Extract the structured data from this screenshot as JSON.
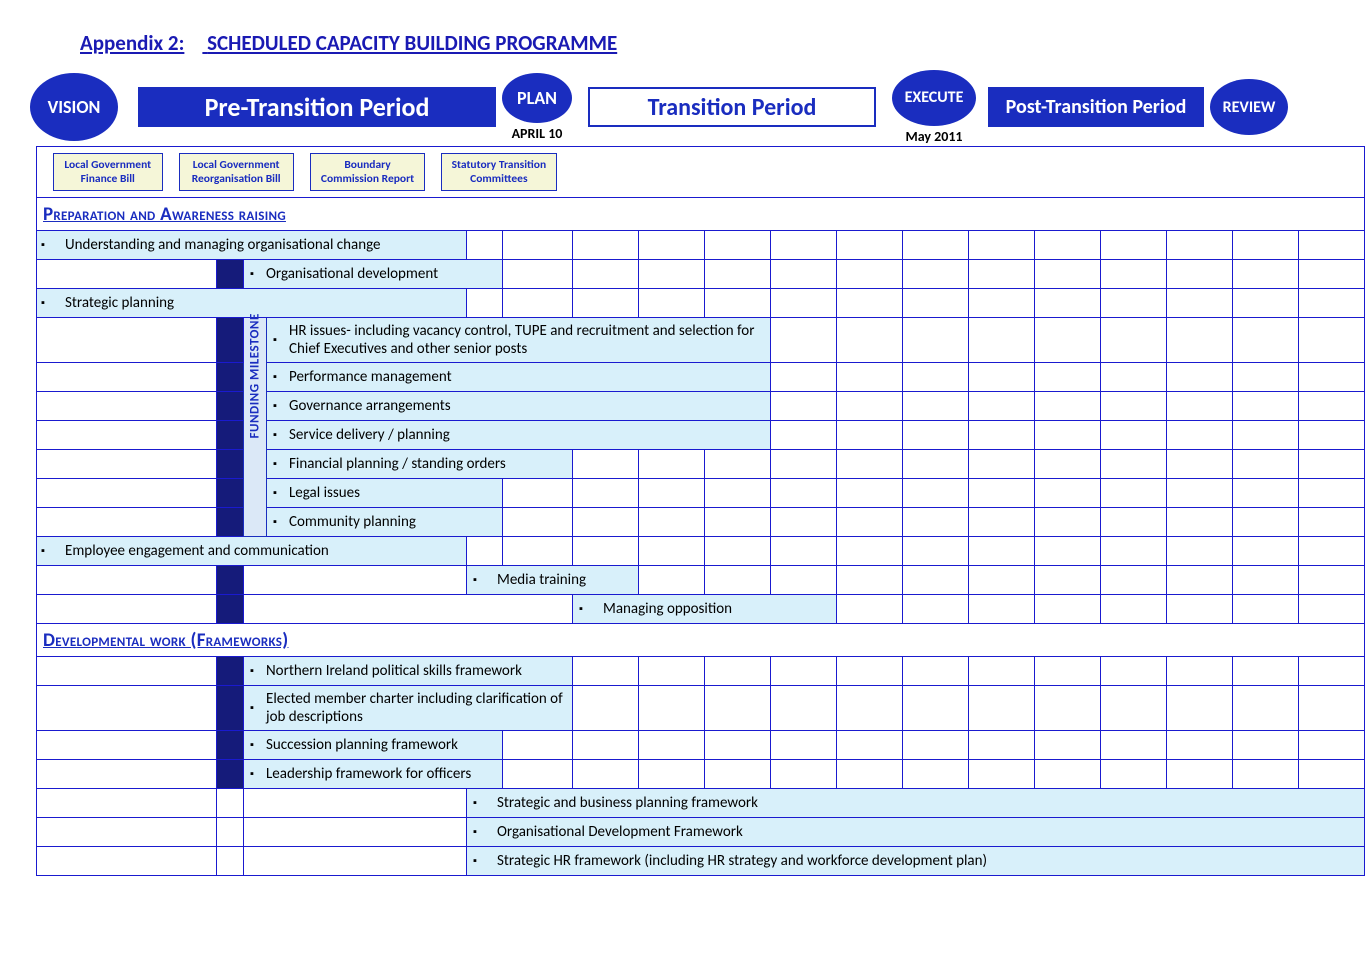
{
  "title_lead": "Appendix 2:",
  "title_main": "SCHEDULED CAPACITY BUILDING PROGRAMME",
  "badges": {
    "vision": "VISION",
    "plan": "PLAN",
    "execute": "EXECUTE",
    "review": "REVIEW"
  },
  "periods": {
    "pre": "Pre-Transition Period",
    "trans": "Transition Period",
    "post": "Post-Transition Period"
  },
  "dates": {
    "april": "APRIL 10",
    "may": "May 2011"
  },
  "tags": {
    "t1a": "Local Government",
    "t1b": "Finance Bill",
    "t2a": "Local Government",
    "t2b": "Reorganisation Bill",
    "t3a": "Boundary",
    "t3b": "Commission Report",
    "t4a": "Statutory Transition",
    "t4b": "Committees"
  },
  "funding": "FUNDING MILESTONE",
  "sections": {
    "s1": "Preparation and Awareness raising",
    "s2": "Developmental work (Frameworks)"
  },
  "rows": {
    "r1": "Understanding and managing organisational change",
    "r2": "Organisational development",
    "r3": "Strategic planning",
    "r4": "HR issues- including vacancy control, TUPE and recruitment and selection for Chief Executives and other senior posts",
    "r5": "Performance management",
    "r6": "Governance arrangements",
    "r7": "Service delivery / planning",
    "r8": "Financial planning / standing orders",
    "r9": "Legal issues",
    "r10": "Community planning",
    "r11": "Employee engagement and communication",
    "r12": "Media training",
    "r13": "Managing opposition",
    "r14": "Northern Ireland political skills framework",
    "r15": "Elected member charter including clarification of job descriptions",
    "r16": "Succession planning framework",
    "r17": "Leadership framework for officers",
    "r18": "Strategic and business planning framework",
    "r19": "Organisational Development Framework",
    "r20": "Strategic HR framework (including HR strategy and workforce development plan)"
  }
}
